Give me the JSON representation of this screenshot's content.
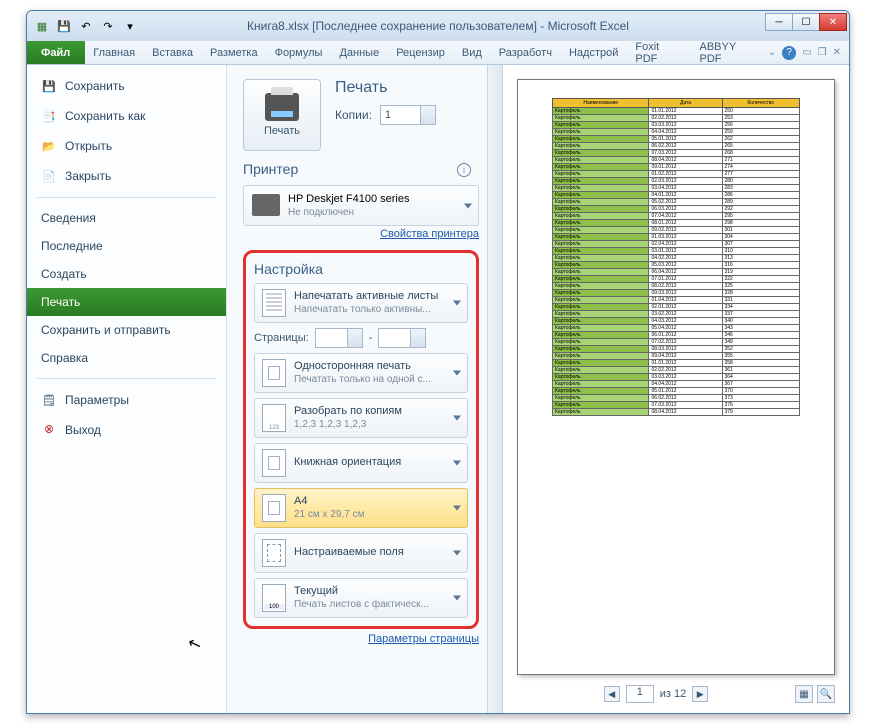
{
  "titlebar": {
    "title": "Книга8.xlsx [Последнее сохранение пользователем] - Microsoft Excel"
  },
  "ribbon": {
    "file": "Файл",
    "tabs": [
      "Главная",
      "Вставка",
      "Разметка",
      "Формулы",
      "Данные",
      "Рецензир",
      "Вид",
      "Разработч",
      "Надстрой",
      "Foxit PDF",
      "ABBYY PDF"
    ]
  },
  "sidebar": {
    "save": "Сохранить",
    "saveas": "Сохранить как",
    "open": "Открыть",
    "close": "Закрыть",
    "info": "Сведения",
    "recent": "Последние",
    "new": "Создать",
    "print": "Печать",
    "share": "Сохранить и отправить",
    "help": "Справка",
    "options": "Параметры",
    "exit": "Выход"
  },
  "print": {
    "title": "Печать",
    "btn": "Печать",
    "copies_label": "Копии:",
    "copies_value": "1",
    "printer_title": "Принтер",
    "printer_name": "HP Deskjet F4100 series",
    "printer_status": "Не подключен",
    "printer_props": "Свойства принтера",
    "settings_title": "Настройка",
    "opt_active": "Напечатать активные листы",
    "opt_active_sub": "Напечатать только активны...",
    "pages_label": "Страницы:",
    "pages_sep": "-",
    "opt_oneside": "Односторонняя печать",
    "opt_oneside_sub": "Печатать только на одной с...",
    "opt_collate": "Разобрать по копиям",
    "opt_collate_sub": "1,2,3   1,2,3   1,2,3",
    "opt_orient": "Книжная ориентация",
    "opt_size": "A4",
    "opt_size_sub": "21 см x 29,7 см",
    "opt_margins": "Настраиваемые поля",
    "opt_scale": "Текущий",
    "opt_scale_sub": "Печать листов с фактическ...",
    "page_setup": "Параметры страницы"
  },
  "preview": {
    "headers": [
      "Наименование",
      "Дата",
      "Количество"
    ],
    "page_current": "1",
    "page_total": "из 12"
  }
}
